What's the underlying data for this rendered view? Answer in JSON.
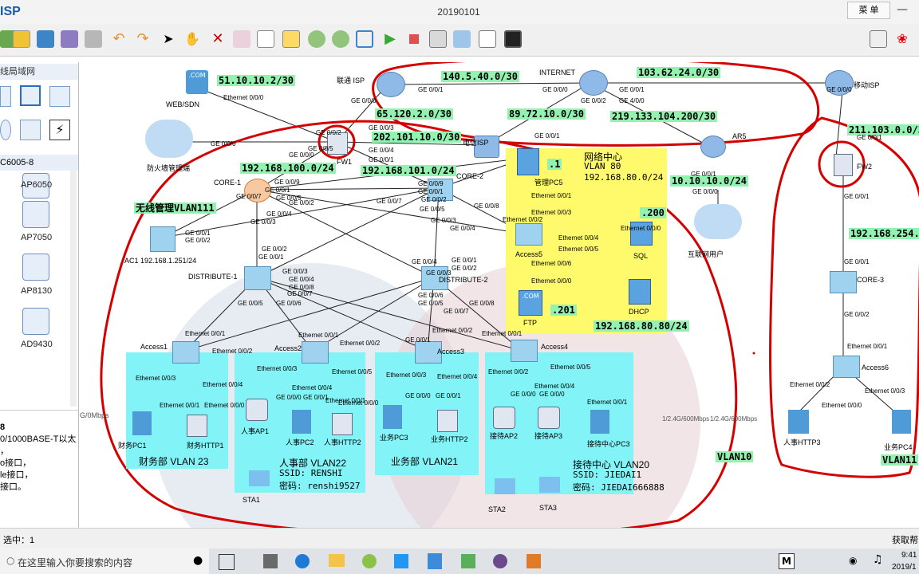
{
  "window": {
    "app_name": "ISP",
    "title": "20190101",
    "menu_label": "菜 单"
  },
  "left_panel": {
    "category": "线局域网",
    "model": "C6005-8",
    "devices": [
      "AP6050",
      "AP7050",
      "AP8130",
      "AD9430"
    ],
    "desc_title": "8",
    "desc_lines": [
      "0/1000BASE-T以太",
      "，",
      "o接口，",
      "le接口，",
      "接口。"
    ],
    "rate_label": "G/0Mbps"
  },
  "status": {
    "left": "选中：1",
    "right": "获取帮"
  },
  "taskbar": {
    "search_placeholder": "在这里输入你要搜索的内容",
    "time": "9:41",
    "date": "2019/1"
  },
  "nodes": {
    "web": "WEB/SDN",
    "unicom": "联通 ISP",
    "internet": "INTERNET",
    "mobile": "移动ISP",
    "telecom": "电信ISP",
    "ar5": "AR5",
    "fw_mgmt": "防火墙管理端",
    "fw1": "FW1",
    "fw2": "FW2",
    "core1": "CORE-1",
    "core2": "CORE-2",
    "core3": "CORE-3",
    "ac1": "AC1 192.168.1.251/24",
    "dist1": "DISTRIBUTE-1",
    "dist2": "DISTRIBUTE-2",
    "access1": "Access1",
    "access2": "Access2",
    "access3": "Access3",
    "access4": "Access4",
    "access5": "Access5",
    "access6": "Access6",
    "mgmt_pc5": "管理PC5",
    "sql": "SQL",
    "ftp": "FTP",
    "dhcp": "DHCP",
    "internet_users": "互联网用户",
    "fin_pc1": "财务PC1",
    "fin_http1": "财务HTTP1",
    "hr_ap1": "人事AP1",
    "hr_pc2": "人事PC2",
    "hr_http2": "人事HTTP2",
    "sta1": "STA1",
    "biz_pc3": "业务PC3",
    "biz_http": "业务HTTP2",
    "rec_ap2": "接待AP2",
    "rec_ap3": "接待AP3",
    "rec_pc3": "接待中心PC3",
    "sta2": "STA2",
    "sta3": "STA3",
    "hr_http3": "人事HTTP3",
    "biz_pc4": "业务PC4"
  },
  "net_labels": {
    "n1": "51.10.10.2/30",
    "n2": "140.5.40.0/30",
    "n3": "103.62.24.0/30",
    "n4": "65.120.2.0/30",
    "n5": "89.72.10.0/30",
    "n6": "219.133.104.200/30",
    "n7": "202.101.10.0/30",
    "n8": "211.103.0.0/3",
    "n9": "192.168.100.0/24",
    "n10": "192.168.101.0/24",
    "n11": "10.10.10.0/24",
    "n12": "无线管理VLAN111",
    "n13": "192.168.254.0",
    "n14": ".1",
    "n15": ".200",
    "n16": ".201",
    "n17": "192.168.80.80/24",
    "n18": "VLAN10",
    "n19": "VLAN11"
  },
  "zones": {
    "netcenter": [
      "网络中心",
      "VLAN 80",
      "192.168.80.0/24"
    ],
    "finance": "财务部  VLAN 23",
    "hr": [
      "人事部  VLAN22",
      "SSID:  RENSHI",
      "密码:  renshi9527"
    ],
    "business": "业务部  VLAN21",
    "reception": [
      "接待中心 VLAN20",
      "SSID:  JIEDAI1",
      "密码:  JIEDAI666888"
    ]
  },
  "rates": {
    "r1": "1/2.4G/600Mbps",
    "r2": "1/2.4G/600Mbps"
  },
  "ports": [
    "Ethernet 0/0/0",
    "GE 0/0/1",
    "GE 0/0/0",
    "GE 0/0/2",
    "GE 0/0/0",
    "GE 4/0/0",
    "GE 0/0/1",
    "GE 0/0/0",
    "GE 0/0/1",
    "GE 0/0/3",
    "GE 0/0/4",
    "GE 0/0/5",
    "GE 0/0/1",
    "GE 0/0/1",
    "GE 0/0/0",
    "GE 0/0/2",
    "GE 0/0/0",
    "GE 0/0/1",
    "GE 0/0/0",
    "GE 0/0/9",
    "GE 0/0/1",
    "GE 0/0/7",
    "GE 0/0/5",
    "GE 0/0/2",
    "GE 0/0/4",
    "GE 0/0/3",
    "GE 0/0/1",
    "GE 0/0/2",
    "GE 0/0/9",
    "GE 0/0/1",
    "GE 0/0/7",
    "GE 0/0/8",
    "GE 0/0/5",
    "GE 0/0/3",
    "GE 0/0/4",
    "GE 0/0/2",
    "GE 0/0/2",
    "GE 0/0/1",
    "GE 0/0/3",
    "GE 0/0/4",
    "GE 0/0/8",
    "GE 0/0/7",
    "GE 0/0/5",
    "GE 0/0/6",
    "GE 0/0/4",
    "GE 0/0/1",
    "GE 0/0/2",
    "GE 0/0/3",
    "GE 0/0/6",
    "GE 0/0/5",
    "GE 0/0/7",
    "GE 0/0/8",
    "Ethernet 0/0/1",
    "Ethernet 0/0/2",
    "Ethernet 0/0/1",
    "Ethernet 0/0/2",
    "GE 0/0/1",
    "Ethernet 0/0/2",
    "Ethernet 0/0/1",
    "Ethernet 0/0/3",
    "Ethernet 0/0/4",
    "Ethernet 0/0/1",
    "Ethernet 0/0/0",
    "Ethernet 0/0/3",
    "Ethernet 0/0/5",
    "Ethernet 0/0/4",
    "GE 0/0/0",
    "GE 0/0/1",
    "Ethernet 0/0/1",
    "Ethernet 0/0/0",
    "Ethernet 0/0/3",
    "Ethernet 0/0/4",
    "GE 0/0/0",
    "GE 0/0/1",
    "Ethernet 0/0/2",
    "Ethernet 0/0/5",
    "GE 0/0/0",
    "GE 0/0/0",
    "Ethernet 0/0/4",
    "Ethernet 0/0/1",
    "Ethernet 0/0/1",
    "Ethernet 0/0/3",
    "Ethernet 0/0/2",
    "Ethernet 0/0/4",
    "Ethernet 0/0/5",
    "Ethernet 0/0/6",
    "Ethernet 0/0/0",
    "Ethernet 0/0/0",
    "GE 0/0/1",
    "GE 0/0/1",
    "GE 0/0/2",
    "Ethernet 0/0/1",
    "Ethernet 0/0/2",
    "Ethernet 0/0/0",
    "Ethernet 0/0/3"
  ],
  "colors": {
    "accent": "#1b5aa6",
    "label_bg": "#94f2b0",
    "cyan_zone": "#82f3f6",
    "yellow_zone": "#fffa6c",
    "annotation": "#d40000"
  }
}
